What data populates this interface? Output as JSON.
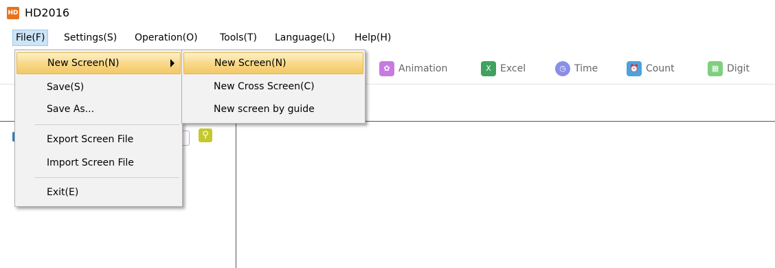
{
  "window": {
    "title": "HD2016",
    "logo_text": "HD"
  },
  "menubar": {
    "items": [
      "File(F)",
      "Settings(S)",
      "Operation(O)",
      "Tools(T)",
      "Language(L)",
      "Help(H)"
    ]
  },
  "file_menu": {
    "items": [
      "New Screen(N)",
      "Save(S)",
      "Save As...",
      "Export Screen File",
      "Import Screen File",
      "Exit(E)"
    ]
  },
  "new_screen_submenu": {
    "items": [
      "New Screen(N)",
      "New Cross Screen(C)",
      "New screen by guide"
    ]
  },
  "toolbar": {
    "buttons": [
      {
        "label": "Animation",
        "icon": "animation-icon",
        "color": "#c77be0"
      },
      {
        "label": "Excel",
        "icon": "excel-icon",
        "color": "#3fa25f"
      },
      {
        "label": "Time",
        "icon": "clock-icon",
        "color": "#8a8ee8"
      },
      {
        "label": "Count",
        "icon": "alarm-clock-icon",
        "color": "#4aa3e0"
      },
      {
        "label": "Digit",
        "icon": "digit-icon",
        "color": "#7ed07e"
      }
    ]
  },
  "left_panel": {
    "search_icon": "search-icon",
    "search_color": "#c5c92e"
  }
}
